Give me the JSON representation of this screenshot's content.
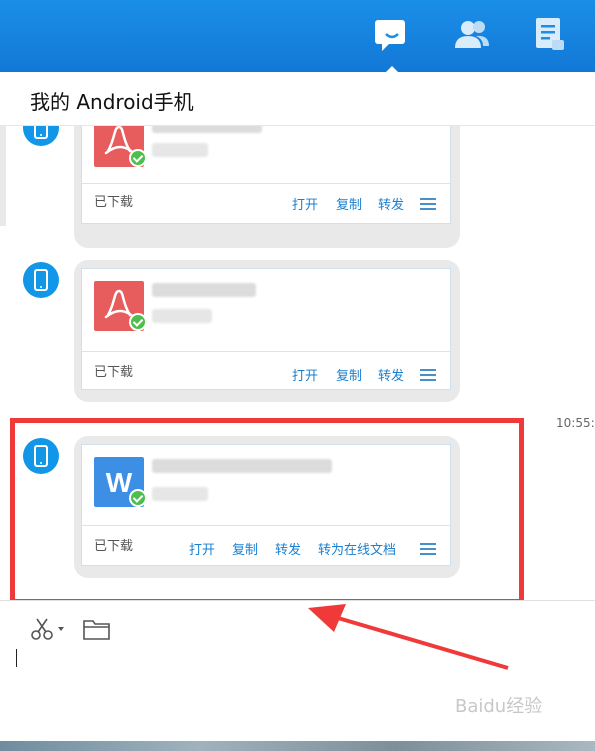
{
  "header": {
    "tabs": [
      {
        "name": "messages",
        "icon": "chat-icon",
        "active": true
      },
      {
        "name": "contacts",
        "icon": "contacts-icon",
        "active": false
      },
      {
        "name": "files",
        "icon": "document-icon",
        "active": false
      }
    ]
  },
  "conversation": {
    "title": "我的 Android手机"
  },
  "messages": [
    {
      "sender_icon": "phone-icon",
      "file_type": "pdf",
      "status": "已下载",
      "actions": [
        "打开",
        "复制",
        "转发"
      ]
    },
    {
      "sender_icon": "phone-icon",
      "file_type": "pdf",
      "status": "已下载",
      "actions": [
        "打开",
        "复制",
        "转发"
      ]
    },
    {
      "timestamp": "10:55:",
      "sender_icon": "phone-icon",
      "file_type": "word",
      "file_icon_letter": "W",
      "status": "已下载",
      "actions": [
        "打开",
        "复制",
        "转发",
        "转为在线文档"
      ]
    }
  ],
  "toolbar": {
    "tools": [
      "screenshot-scissors-icon",
      "folder-icon"
    ]
  },
  "watermark": "Baidu经验",
  "colors": {
    "header_blue": "#1a8fe8",
    "link_blue": "#1a7fcf",
    "highlight_red": "#f03a3a",
    "pdf_red": "#e75c5c",
    "word_blue": "#3d8fe6",
    "check_green": "#4cbf4c"
  }
}
